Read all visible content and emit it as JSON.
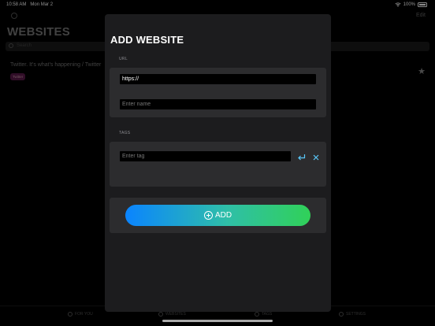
{
  "status_bar": {
    "time": "10:58 AM",
    "date": "Mon Mar 2",
    "battery": "100%"
  },
  "background": {
    "edit_label": "Edit",
    "title": "WEBSITES",
    "search_placeholder": "Search",
    "site_title": "Twitter. It's what's happening / Twitter",
    "site_tag": "Twitter",
    "tabs": [
      {
        "label": "FOR YOU",
        "icon": "for-you-icon"
      },
      {
        "label": "WEBSITES",
        "icon": "websites-icon"
      },
      {
        "label": "TAGS",
        "icon": "tags-icon"
      },
      {
        "label": "SETTINGS",
        "icon": "settings-icon"
      }
    ]
  },
  "modal": {
    "title": "ADD WEBSITE",
    "url_section_label": "URL",
    "url_value": "https://",
    "name_placeholder": "Enter name",
    "tags_section_label": "TAGS",
    "tag_placeholder": "Enter tag",
    "add_label": "ADD"
  },
  "colors": {
    "accent_blue": "#0a84ff",
    "accent_green": "#30d158",
    "tag_purple": "#5a1a4a"
  }
}
